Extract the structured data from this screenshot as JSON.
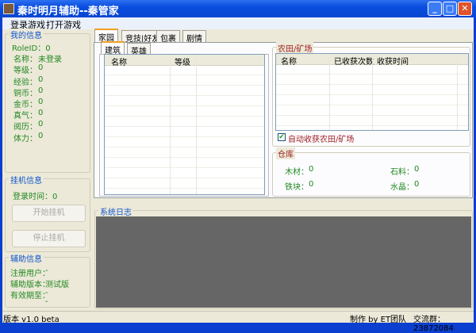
{
  "window": {
    "title": "秦时明月辅助--秦管家"
  },
  "menu": [
    "登录游戏",
    "打开游戏"
  ],
  "my_info": {
    "title": "我的信息",
    "role_id": "RoleID：0",
    "rows": [
      {
        "label": "名称：",
        "value": "未登录"
      },
      {
        "label": "等级：",
        "value": "0"
      },
      {
        "label": "经验：",
        "value": "0"
      },
      {
        "label": "铜币：",
        "value": "0"
      },
      {
        "label": "金币：",
        "value": "0"
      },
      {
        "label": "真气：",
        "value": "0"
      },
      {
        "label": "阅历：",
        "value": "0"
      },
      {
        "label": "体力：",
        "value": "0"
      }
    ]
  },
  "idle": {
    "title": "挂机信息",
    "login_time": "登录时间：0",
    "start": "开始挂机",
    "stop": "停止挂机"
  },
  "assist": {
    "title": "辅助信息",
    "user_label": "注册用户：",
    "user": "-",
    "version_label": "辅助版本：",
    "version": "测试版",
    "expire_label": "有效期至：",
    "expire": "-",
    "expire2": "-"
  },
  "tabs": [
    "家园",
    "竞技|好友",
    "包裹",
    "剧情"
  ],
  "subtabs": [
    "建筑",
    "英雄"
  ],
  "building_list": {
    "columns": [
      "名称",
      "等级"
    ]
  },
  "farm": {
    "title": "农田/矿场",
    "columns": [
      "名称",
      "已收获次数",
      "收获时间"
    ],
    "auto_harvest": "自动收获农田/矿场",
    "checked": true
  },
  "warehouse": {
    "title": "仓库",
    "items": [
      {
        "label": "木材：",
        "value": "0"
      },
      {
        "label": "石料：",
        "value": "0"
      },
      {
        "label": "铁块：",
        "value": "0"
      },
      {
        "label": "水晶：",
        "value": "0"
      }
    ]
  },
  "log": {
    "title": "系统日志"
  },
  "status": {
    "version": "版本 v1.0 beta",
    "author": "制作 by ET团队",
    "group": "交流群：23872084"
  }
}
